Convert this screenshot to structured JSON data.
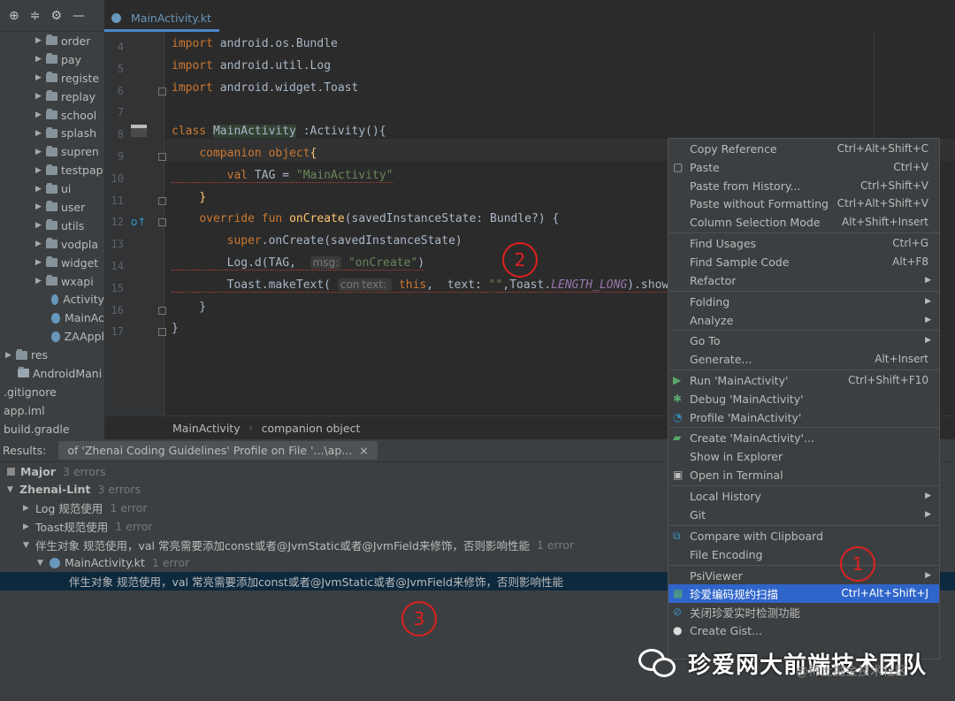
{
  "editor": {
    "tab_title": "MainActivity.kt",
    "lines": [
      {
        "n": "4",
        "code": "import android.os.Bundle"
      },
      {
        "n": "5",
        "code": "import android.util.Log"
      },
      {
        "n": "6",
        "code": "import android.widget.Toast"
      },
      {
        "n": "7",
        "code": ""
      },
      {
        "n": "8",
        "code": "class MainActivity :Activity(){"
      },
      {
        "n": "9",
        "code": "    companion object{"
      },
      {
        "n": "10",
        "code": "        val TAG = \"MainActivity\""
      },
      {
        "n": "11",
        "code": "    }"
      },
      {
        "n": "12",
        "code": "    override fun onCreate(savedInstanceState: Bundle?) {"
      },
      {
        "n": "13",
        "code": "        super.onCreate(savedInstanceState)"
      },
      {
        "n": "14",
        "code": "        Log.d(TAG,  msg: \"onCreate\")"
      },
      {
        "n": "15",
        "code": "        Toast.makeText( context: this,  text: \"\",Toast.LENGTH_LONG).show()"
      },
      {
        "n": "16",
        "code": "    }"
      },
      {
        "n": "17",
        "code": "}"
      }
    ],
    "breadcrumb": [
      "MainActivity",
      "companion object"
    ]
  },
  "project": {
    "items": [
      {
        "label": "order",
        "type": "folder"
      },
      {
        "label": "pay",
        "type": "folder"
      },
      {
        "label": "registe",
        "type": "folder"
      },
      {
        "label": "replay",
        "type": "folder"
      },
      {
        "label": "school",
        "type": "folder"
      },
      {
        "label": "splash",
        "type": "folder"
      },
      {
        "label": "supren",
        "type": "folder"
      },
      {
        "label": "testpap",
        "type": "folder"
      },
      {
        "label": "ui",
        "type": "folder"
      },
      {
        "label": "user",
        "type": "folder"
      },
      {
        "label": "utils",
        "type": "folder"
      },
      {
        "label": "vodpla",
        "type": "folder"
      },
      {
        "label": "widget",
        "type": "folder"
      },
      {
        "label": "wxapi",
        "type": "folder"
      },
      {
        "label": "Activity",
        "type": "file"
      },
      {
        "label": "MainAc",
        "type": "file"
      },
      {
        "label": "ZAAppl",
        "type": "file"
      },
      {
        "label": "res",
        "type": "res"
      },
      {
        "label": "AndroidMani",
        "type": "manifest"
      },
      {
        "label": ".gitignore",
        "type": "plain"
      },
      {
        "label": "app.iml",
        "type": "plain"
      },
      {
        "label": "build.gradle",
        "type": "plain"
      }
    ]
  },
  "results": {
    "header_label": "Results:",
    "tab_label": "of 'Zhenai Coding Guidelines' Profile on File '...\\ap...",
    "tab_close": "×",
    "rows": [
      {
        "label": "Major",
        "count": "3 errors"
      },
      {
        "label": "Zhenai-Lint",
        "count": "3 errors"
      },
      {
        "label": "Log 规范使用",
        "count": "1 error"
      },
      {
        "label": "Toast规范使用",
        "count": "1 error"
      },
      {
        "label": "伴生对象 规范使用，val 常亮需要添加const或者@JvmStatic或者@JvmField来修饰，否则影响性能",
        "count": "1 error"
      },
      {
        "label": "MainActivity.kt",
        "count": "1 error"
      },
      {
        "label": "伴生对象 规范使用，val 常亮需要添加const或者@JvmStatic或者@JvmField来修饰，否则影响性能",
        "count": ""
      }
    ]
  },
  "context_menu": {
    "items": [
      {
        "label": "Copy Reference",
        "shortcut": "Ctrl+Alt+Shift+C"
      },
      {
        "label": "Paste",
        "shortcut": "Ctrl+V"
      },
      {
        "label": "Paste from History...",
        "shortcut": "Ctrl+Shift+V"
      },
      {
        "label": "Paste without Formatting",
        "shortcut": "Ctrl+Alt+Shift+V"
      },
      {
        "label": "Column Selection Mode",
        "shortcut": "Alt+Shift+Insert"
      },
      {
        "label": "Find Usages",
        "shortcut": "Ctrl+G"
      },
      {
        "label": "Find Sample Code",
        "shortcut": "Alt+F8"
      },
      {
        "label": "Refactor",
        "shortcut": ""
      },
      {
        "label": "Folding",
        "shortcut": ""
      },
      {
        "label": "Analyze",
        "shortcut": ""
      },
      {
        "label": "Go To",
        "shortcut": ""
      },
      {
        "label": "Generate...",
        "shortcut": "Alt+Insert"
      },
      {
        "label": "Run 'MainActivity'",
        "shortcut": "Ctrl+Shift+F10"
      },
      {
        "label": "Debug 'MainActivity'",
        "shortcut": ""
      },
      {
        "label": "Profile 'MainActivity'",
        "shortcut": ""
      },
      {
        "label": "Create 'MainActivity'...",
        "shortcut": ""
      },
      {
        "label": "Show in Explorer",
        "shortcut": ""
      },
      {
        "label": "Open in Terminal",
        "shortcut": ""
      },
      {
        "label": "Local History",
        "shortcut": ""
      },
      {
        "label": "Git",
        "shortcut": ""
      },
      {
        "label": "Compare with Clipboard",
        "shortcut": ""
      },
      {
        "label": "File Encoding",
        "shortcut": ""
      },
      {
        "label": "PsiViewer",
        "shortcut": ""
      },
      {
        "label": "珍爱编码规约扫描",
        "shortcut": "Ctrl+Alt+Shift+J"
      },
      {
        "label": "关闭珍爱实时检测功能",
        "shortcut": ""
      },
      {
        "label": "Create Gist...",
        "shortcut": ""
      }
    ]
  },
  "annotations": [
    "1",
    "2",
    "3"
  ],
  "watermark": {
    "title": "珍爱网大前端技术团队",
    "sub": "@稀土掘金技术社区"
  },
  "colors": {
    "accent": "#2f65ca",
    "annotation": "#e02020",
    "selection": "#0d293e"
  }
}
